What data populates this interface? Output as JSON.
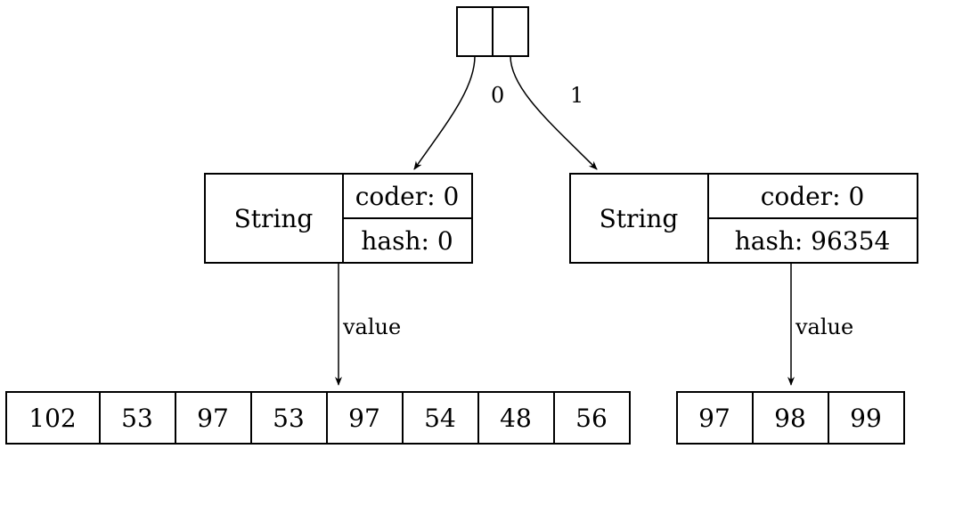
{
  "root": {
    "cells": [
      "",
      ""
    ]
  },
  "edges": {
    "root_left": "0",
    "root_right": "1",
    "left_value": "value",
    "right_value": "value"
  },
  "left_string": {
    "type": "String",
    "coder": "coder: 0",
    "hash": "hash: 0"
  },
  "right_string": {
    "type": "String",
    "coder": "coder: 0",
    "hash": "hash: 96354"
  },
  "left_array": [
    "102",
    "53",
    "97",
    "53",
    "97",
    "54",
    "48",
    "56"
  ],
  "right_array": [
    "97",
    "98",
    "99"
  ]
}
